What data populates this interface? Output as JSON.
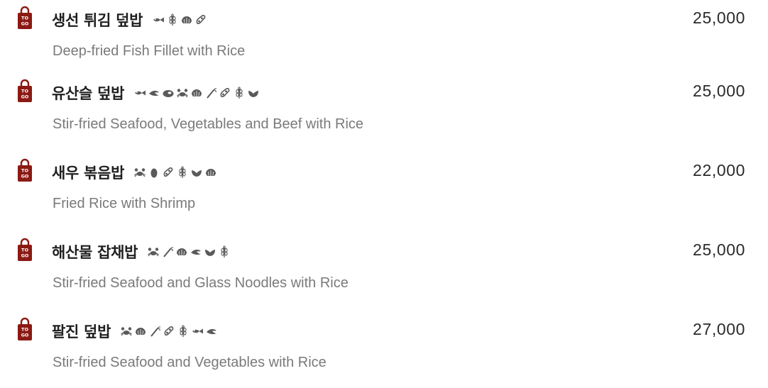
{
  "togo_icon_text": [
    "TO",
    "GO"
  ],
  "items": [
    {
      "name": "생선 튀김 덮밥",
      "desc": "Deep-fried Fish Fillet with Rice",
      "price": "25,000",
      "allergens": [
        "fish-icon",
        "wheat-icon",
        "shellfish-icon",
        "soy-icon"
      ]
    },
    {
      "name": "유산슬 덮밥",
      "desc": "Stir-fried Seafood, Vegetables and Beef with Rice",
      "price": "25,000",
      "allergens": [
        "fish-icon",
        "squid-icon",
        "beef-icon",
        "crab-icon",
        "shellfish-icon",
        "shrimp-icon",
        "soy-icon",
        "wheat-icon",
        "mussel-icon"
      ]
    },
    {
      "name": "새우 볶음밥",
      "desc": "Fried Rice with Shrimp",
      "price": "22,000",
      "allergens": [
        "crab-icon",
        "egg-icon",
        "soy-icon",
        "wheat-icon",
        "mussel-icon",
        "shellfish-icon"
      ]
    },
    {
      "name": "해산물 잡채밥",
      "desc": "Stir-fried Seafood and Glass Noodles with Rice",
      "price": "25,000",
      "allergens": [
        "crab-icon",
        "shrimp-icon",
        "shellfish-icon",
        "squid-icon",
        "mussel-icon",
        "wheat-icon"
      ]
    },
    {
      "name": "팔진 덮밥",
      "desc": "Stir-fried Seafood and Vegetables with Rice",
      "price": "27,000",
      "allergens": [
        "crab-icon",
        "shellfish-icon",
        "shrimp-icon",
        "soy-icon",
        "wheat-icon",
        "fish-icon",
        "squid-icon"
      ]
    }
  ],
  "colors": {
    "togo_bag": "#8b1a14",
    "allergen": "#5a5a5a",
    "name": "#1f1f1f",
    "desc": "#7a7a7a",
    "price": "#2a2a2a"
  }
}
